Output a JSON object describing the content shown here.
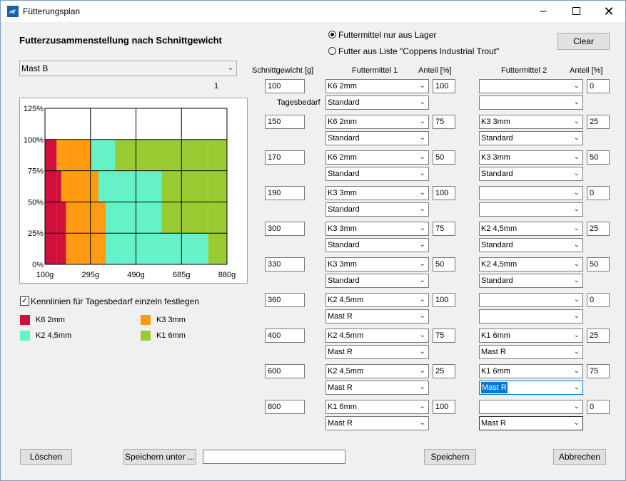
{
  "window": {
    "title": "Fütterungsplan"
  },
  "header": {
    "title": "Futterzusammenstellung nach Schnittgewicht"
  },
  "mast_select": {
    "value": "Mast B"
  },
  "page_number": "1",
  "radio": {
    "lager_label": "Futtermittel nur aus Lager",
    "liste_label": "Futter aus Liste \"Coppens Industrial Trout\"",
    "selected": "lager"
  },
  "clear_label": "Clear",
  "columns": {
    "weight": "Schnittgewicht [g]",
    "feed1": "Futtermittel 1",
    "share1": "Anteil [%]",
    "feed2": "Futtermittel 2",
    "share2": "Anteil  [%]",
    "tagesbedarf": "Tagesbedarf"
  },
  "rows": [
    {
      "weight": "100",
      "f1": "K6 2mm",
      "r1": "Standard",
      "a1": "100",
      "f2": "",
      "r2": "",
      "a2": "0"
    },
    {
      "weight": "150",
      "f1": "K6 2mm",
      "r1": "Standard",
      "a1": "75",
      "f2": "K3 3mm",
      "r2": "Standard",
      "a2": "25"
    },
    {
      "weight": "170",
      "f1": "K6 2mm",
      "r1": "Standard",
      "a1": "50",
      "f2": "K3 3mm",
      "r2": "Standard",
      "a2": "50"
    },
    {
      "weight": "190",
      "f1": "K3 3mm",
      "r1": "Standard",
      "a1": "100",
      "f2": "",
      "r2": "",
      "a2": "0"
    },
    {
      "weight": "300",
      "f1": "K3 3mm",
      "r1": "Standard",
      "a1": "75",
      "f2": "K2 4,5mm",
      "r2": "Standard",
      "a2": "25"
    },
    {
      "weight": "330",
      "f1": "K3 3mm",
      "r1": "Standard",
      "a1": "50",
      "f2": "K2 4,5mm",
      "r2": "Standard",
      "a2": "50"
    },
    {
      "weight": "360",
      "f1": "K2 4,5mm",
      "r1": "Mast R",
      "a1": "100",
      "f2": "",
      "r2": "",
      "a2": "0"
    },
    {
      "weight": "400",
      "f1": "K2 4,5mm",
      "r1": "Mast R",
      "a1": "75",
      "f2": "K1 6mm",
      "r2": "Mast R",
      "a2": "25"
    },
    {
      "weight": "600",
      "f1": "K2 4,5mm",
      "r1": "Mast R",
      "a1": "25",
      "f2": "K1 6mm",
      "r2": "Mast R",
      "a2": "75"
    },
    {
      "weight": "800",
      "f1": "K1 6mm",
      "r1": "Mast R",
      "a1": "100",
      "f2": "",
      "r2": "Mast R",
      "a2": "0"
    }
  ],
  "checkbox": {
    "label": "Kennlinien für Tagesbedarf einzeln festlegen",
    "checked": true
  },
  "legend": [
    {
      "name": "K6 2mm",
      "color": "#d0103a"
    },
    {
      "name": "K3 3mm",
      "color": "#ff9b10"
    },
    {
      "name": "K2 4,5mm",
      "color": "#66f2c8"
    },
    {
      "name": "K1 6mm",
      "color": "#99cc33"
    }
  ],
  "buttons": {
    "loeschen": "Löschen",
    "speichern_unter": "Speichern unter ...",
    "filename_value": "",
    "speichern": "Speichern",
    "abbrechen": "Abbrechen"
  },
  "chart_data": {
    "type": "area",
    "x": [
      100,
      150,
      170,
      190,
      300,
      330,
      360,
      400,
      600,
      800
    ],
    "xlim": [
      100,
      880
    ],
    "ylim": [
      0,
      125
    ],
    "x_ticks": [
      "100g",
      "295g",
      "490g",
      "685g",
      "880g"
    ],
    "y_ticks": [
      "0%",
      "25%",
      "50%",
      "75%",
      "100%",
      "125%"
    ],
    "grid": true,
    "stack_order": [
      "K6 2mm",
      "K3 3mm",
      "K2 4,5mm",
      "K1 6mm"
    ],
    "series": [
      {
        "name": "K6 2mm",
        "values": [
          100,
          75,
          50,
          0,
          0,
          0,
          0,
          0,
          0,
          0
        ]
      },
      {
        "name": "K3 3mm",
        "values": [
          0,
          25,
          50,
          100,
          75,
          50,
          0,
          0,
          0,
          0
        ]
      },
      {
        "name": "K2 4,5mm",
        "values": [
          0,
          0,
          0,
          0,
          25,
          50,
          100,
          75,
          25,
          0
        ]
      },
      {
        "name": "K1 6mm",
        "values": [
          0,
          0,
          0,
          0,
          0,
          0,
          0,
          25,
          75,
          100
        ]
      }
    ]
  }
}
